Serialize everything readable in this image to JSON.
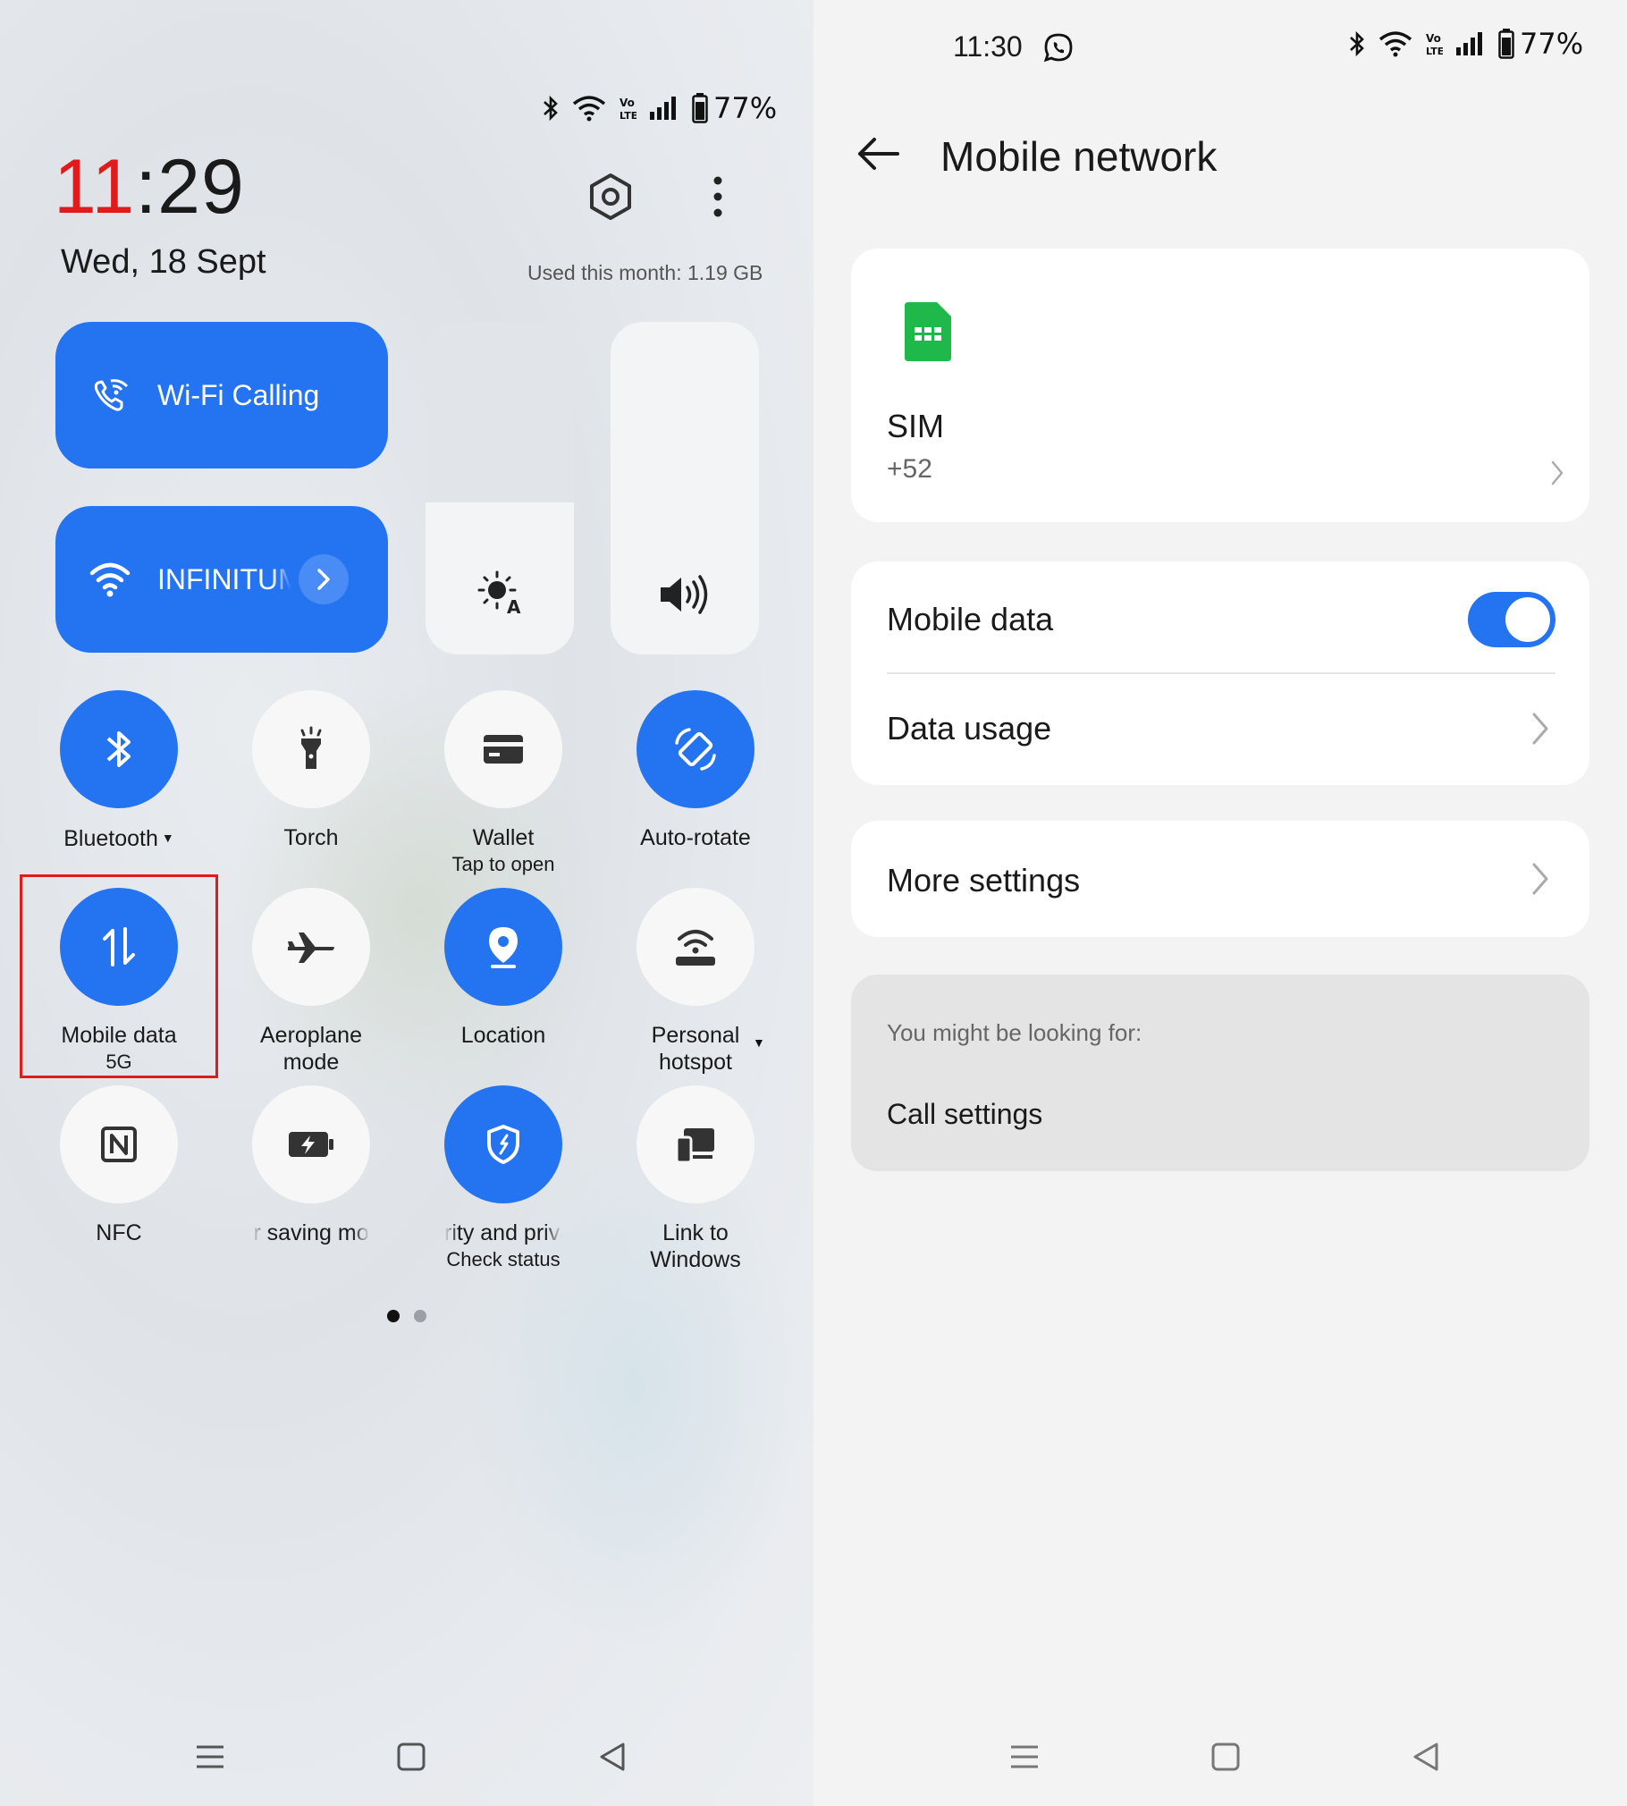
{
  "left": {
    "status": {
      "battery": "77%"
    },
    "clock": {
      "hour": "11",
      "rest": ":29"
    },
    "date": "Wed, 18 Sept",
    "used_this_month": "Used this month: 1.19 GB",
    "wifi_calling": "Wi-Fi Calling",
    "network": "INFINITUM",
    "tiles": [
      {
        "label": "Bluetooth",
        "sub": ""
      },
      {
        "label": "Torch",
        "sub": ""
      },
      {
        "label": "Wallet",
        "sub": "Tap to open"
      },
      {
        "label": "Auto-rotate",
        "sub": ""
      },
      {
        "label": "Mobile data",
        "sub": "5G"
      },
      {
        "label": "Aeroplane",
        "sub": "mode"
      },
      {
        "label": "Location",
        "sub": ""
      },
      {
        "label": "Personal",
        "sub": "hotspot"
      },
      {
        "label": "NFC",
        "sub": ""
      },
      {
        "label": "r saving mo",
        "sub": ""
      },
      {
        "label": "rity and priva",
        "sub": "Check status"
      },
      {
        "label": "Link to",
        "sub": "Windows"
      }
    ],
    "page_dots": {
      "current": 1,
      "total": 2
    }
  },
  "right": {
    "status": {
      "time": "11:30",
      "battery": "77%"
    },
    "header": {
      "title": "Mobile network"
    },
    "sim": {
      "name": "SIM",
      "number": "+52"
    },
    "mobile_data": {
      "label": "Mobile data",
      "on": true
    },
    "data_usage": {
      "label": "Data usage"
    },
    "more_settings": {
      "label": "More settings"
    },
    "suggestions": {
      "heading": "You might be looking for:",
      "item": "Call settings"
    }
  },
  "colors": {
    "accent": "#2474f2",
    "highlight": "#e11b1b",
    "sim_green": "#1fb84a"
  }
}
